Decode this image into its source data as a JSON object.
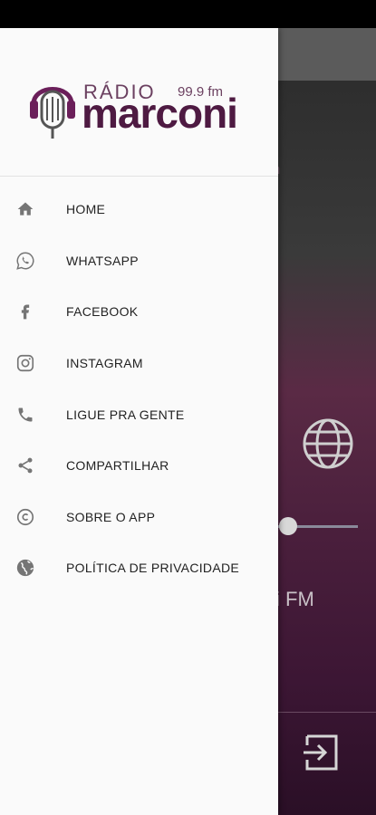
{
  "background_app": {
    "logo_fragment": "ni",
    "logo_small_fragment": "m",
    "station_fragment": "i FM"
  },
  "drawer": {
    "brand": {
      "radio_label": "RÁDIO",
      "frequency": "99.9 fm",
      "name": "marconi",
      "accent_color": "#4e1a42"
    },
    "menu": [
      {
        "label": "HOME",
        "icon": "home-icon"
      },
      {
        "label": "WHATSAPP",
        "icon": "whatsapp-icon"
      },
      {
        "label": "FACEBOOK",
        "icon": "facebook-icon"
      },
      {
        "label": "INSTAGRAM",
        "icon": "instagram-icon"
      },
      {
        "label": "LIGUE PRA GENTE",
        "icon": "phone-icon"
      },
      {
        "label": "COMPARTILHAR",
        "icon": "share-icon"
      },
      {
        "label": "SOBRE O APP",
        "icon": "copyright-icon"
      },
      {
        "label": "POLÍTICA DE PRIVACIDADE",
        "icon": "globe-icon"
      }
    ]
  }
}
